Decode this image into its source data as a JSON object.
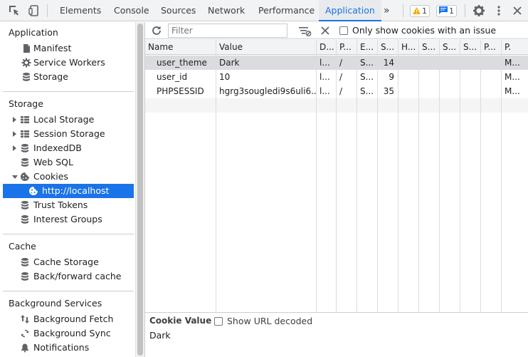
{
  "devtools": {
    "tabs": [
      "Elements",
      "Console",
      "Sources",
      "Network",
      "Performance",
      "Application"
    ],
    "active_tab": "Application",
    "more_tabs_glyph": "»",
    "warning_count": "1",
    "message_count": "1",
    "icons": [
      "inspect-element-icon",
      "device-toolbar-icon",
      "warning-icon",
      "message-icon",
      "gear-icon",
      "more-vertical-icon",
      "close-icon"
    ]
  },
  "sidebar": {
    "application": {
      "heading": "Application",
      "items": [
        {
          "label": "Manifest",
          "icon": "document-icon"
        },
        {
          "label": "Service Workers",
          "icon": "gear-icon"
        },
        {
          "label": "Storage",
          "icon": "database-icon"
        }
      ]
    },
    "storage": {
      "heading": "Storage",
      "items": [
        {
          "label": "Local Storage",
          "icon": "grid-icon",
          "expandable": true
        },
        {
          "label": "Session Storage",
          "icon": "grid-icon",
          "expandable": true
        },
        {
          "label": "IndexedDB",
          "icon": "database-icon",
          "expandable": true
        },
        {
          "label": "Web SQL",
          "icon": "database-icon"
        },
        {
          "label": "Cookies",
          "icon": "cookie-icon",
          "expanded": true
        },
        {
          "label": "http://localhost",
          "icon": "cookie-icon",
          "selected": true
        },
        {
          "label": "Trust Tokens",
          "icon": "database-icon"
        },
        {
          "label": "Interest Groups",
          "icon": "database-icon"
        }
      ]
    },
    "cache": {
      "heading": "Cache",
      "items": [
        {
          "label": "Cache Storage",
          "icon": "database-icon"
        },
        {
          "label": "Back/forward cache",
          "icon": "database-icon"
        }
      ]
    },
    "background": {
      "heading": "Background Services",
      "items": [
        {
          "label": "Background Fetch",
          "icon": "arrows-updown-icon"
        },
        {
          "label": "Background Sync",
          "icon": "sync-icon"
        },
        {
          "label": "Notifications",
          "icon": "bell-icon"
        }
      ]
    }
  },
  "toolbar": {
    "filter_placeholder": "Filter",
    "only_issue_label": "Only show cookies with an issue"
  },
  "table": {
    "columns": [
      "Name",
      "Value",
      "D...",
      "P...",
      "E...",
      "S...",
      "H...",
      "S...",
      "S...",
      "S...",
      "P...",
      "P."
    ],
    "rows": [
      [
        "user_theme",
        "Dark",
        "l...",
        "/",
        "S...",
        "14",
        "",
        "",
        "",
        "",
        "",
        "M..."
      ],
      [
        "user_id",
        "10",
        "l...",
        "/",
        "S...",
        "9",
        "",
        "",
        "",
        "",
        "",
        "M..."
      ],
      [
        "PHPSESSID",
        "hgrg3sougledi9s6uli6...",
        "l...",
        "/",
        "S...",
        "35",
        "",
        "",
        "",
        "",
        "",
        "M..."
      ]
    ],
    "selected_row": 0
  },
  "cookie_value": {
    "title": "Cookie Value",
    "decode_label": "Show URL decoded",
    "value": "Dark"
  },
  "colors": {
    "accent": "#1a73e8",
    "selected_row": "#dadce0",
    "warning": "#f9ab00"
  }
}
